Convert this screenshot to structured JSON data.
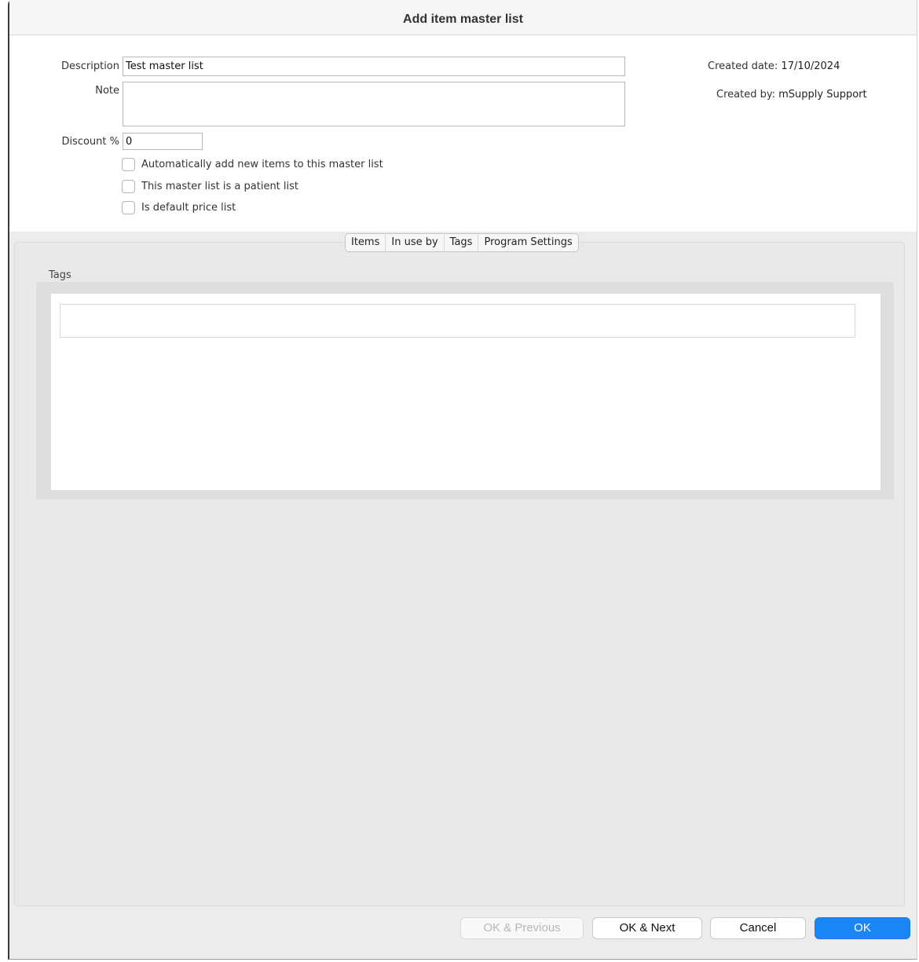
{
  "window": {
    "title": "Add item master list"
  },
  "form": {
    "description_label": "Description",
    "description_value": "Test master list",
    "note_label": "Note",
    "note_value": "",
    "discount_label": "Discount %",
    "discount_value": "0",
    "checkboxes": [
      {
        "label": "Automatically add new items to this master list",
        "checked": false
      },
      {
        "label": "This master list is a patient list",
        "checked": false
      },
      {
        "label": "Is default price list",
        "checked": false
      }
    ]
  },
  "meta": {
    "created_date_label": "Created date:",
    "created_date_value": "17/10/2024",
    "created_by_label": "Created by:",
    "created_by_value": "mSupply Support"
  },
  "tabs": [
    "Items",
    "In use by",
    "Tags",
    "Program Settings"
  ],
  "active_tab": "Tags",
  "tags_panel": {
    "label": "Tags",
    "value": ""
  },
  "buttons": {
    "ok_previous": "OK & Previous",
    "ok_next": "OK & Next",
    "cancel": "Cancel",
    "ok": "OK"
  },
  "colors": {
    "primary_button": "#1a86f5",
    "panel_bg": "#e9e9e9"
  }
}
